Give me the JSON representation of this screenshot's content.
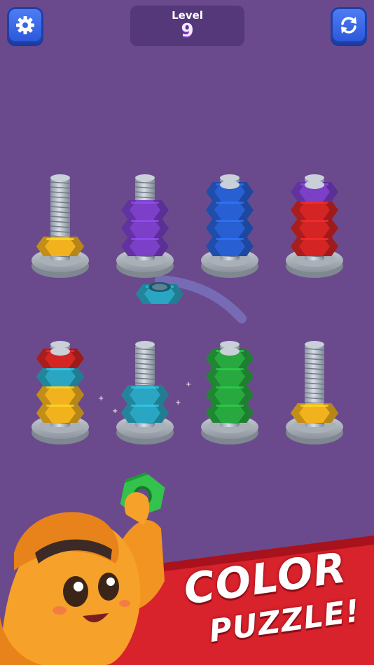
{
  "header": {
    "level_label": "Level",
    "level_number": "9",
    "settings_icon": "gear-icon",
    "restart_icon": "refresh-icon"
  },
  "colors": {
    "background": "#6a4a8c",
    "yellow": "#f2b21e",
    "purple": "#7b3fc8",
    "blue": "#2860d4",
    "red": "#d42424",
    "teal": "#2aa6c2",
    "green": "#27a93f",
    "banner_red": "#d8222c"
  },
  "bolts": [
    {
      "row": 1,
      "nuts_bottom_to_top": [
        "yellow"
      ]
    },
    {
      "row": 1,
      "nuts_bottom_to_top": [
        "purple",
        "purple",
        "purple"
      ]
    },
    {
      "row": 1,
      "nuts_bottom_to_top": [
        "blue",
        "blue",
        "blue",
        "blue"
      ]
    },
    {
      "row": 1,
      "nuts_bottom_to_top": [
        "red",
        "red",
        "red",
        "purple"
      ]
    },
    {
      "row": 2,
      "nuts_bottom_to_top": [
        "yellow",
        "yellow",
        "teal",
        "red"
      ]
    },
    {
      "row": 2,
      "nuts_bottom_to_top": [
        "teal",
        "teal"
      ]
    },
    {
      "row": 2,
      "nuts_bottom_to_top": [
        "green",
        "green",
        "green",
        "green"
      ]
    },
    {
      "row": 2,
      "nuts_bottom_to_top": [
        "yellow"
      ]
    }
  ],
  "flying_nut": "teal",
  "banner": {
    "line1": "COLOR",
    "line2": "PUZZLE!"
  },
  "mascot": "orange-nut-mascot",
  "held_nut": "green"
}
